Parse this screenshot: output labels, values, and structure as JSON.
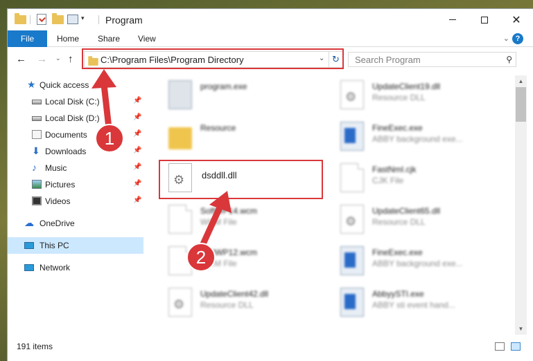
{
  "window": {
    "title": "Program",
    "min_glyph": "—",
    "max_glyph": "",
    "close_glyph": "✕"
  },
  "quick_access_toolbar": {
    "icons": [
      "folder-icon",
      "properties-check-icon",
      "new-folder-icon",
      "customize-icon"
    ],
    "dropdown_glyph": "▾"
  },
  "ribbon": {
    "tabs": [
      "File",
      "Home",
      "Share",
      "View"
    ],
    "expand_glyph": "⌄",
    "help_glyph": "?"
  },
  "navigation": {
    "back_glyph": "←",
    "forward_glyph": "→",
    "recent_glyph": "⌄",
    "up_glyph": "↑"
  },
  "address": {
    "path": "C:\\Program Files\\Program Directory",
    "dropdown_glyph": "⌄",
    "refresh_glyph": "↻"
  },
  "search": {
    "placeholder": "Search Program",
    "icon_glyph": "⚲"
  },
  "sidebar": {
    "items": [
      {
        "label": "Quick access",
        "icon": "star-icon",
        "pin": ""
      },
      {
        "label": "Local Disk (C:)",
        "icon": "disk-icon",
        "pin": "📌"
      },
      {
        "label": "Local Disk (D:)",
        "icon": "disk-icon",
        "pin": "📌"
      },
      {
        "label": "Documents",
        "icon": "documents-icon",
        "pin": "📌"
      },
      {
        "label": "Downloads",
        "icon": "download-icon",
        "pin": "📌"
      },
      {
        "label": "Music",
        "icon": "music-icon",
        "pin": "📌"
      },
      {
        "label": "Pictures",
        "icon": "pictures-icon",
        "pin": "📌"
      },
      {
        "label": "Videos",
        "icon": "videos-icon",
        "pin": "📌"
      },
      {
        "label": "OneDrive",
        "icon": "cloud-icon",
        "pin": ""
      },
      {
        "label": "This PC",
        "icon": "computer-icon",
        "pin": ""
      },
      {
        "label": "Network",
        "icon": "network-icon",
        "pin": ""
      }
    ],
    "selected": "This PC"
  },
  "files": {
    "left": [
      {
        "name": "program.exe",
        "type": "",
        "icon": "program-icon"
      },
      {
        "name": "Resource",
        "type": "",
        "icon": "folder-icon"
      },
      {
        "name": "dsddll.dll",
        "type": "",
        "icon": "dll-icon"
      },
      {
        "name": "SoftWP14.wcm",
        "type": "WCM File",
        "icon": "document-icon"
      },
      {
        "name": "SoftWP12.wcm",
        "type": "WCM File",
        "icon": "document-icon"
      },
      {
        "name": "UpdateClient42.dll",
        "type": "Resource DLL",
        "icon": "dll-icon"
      }
    ],
    "right": [
      {
        "name": "UpdateClient19.dll",
        "type": "Resource DLL",
        "icon": "dll-icon"
      },
      {
        "name": "FineExec.exe",
        "type": "ABBY background exe...",
        "icon": "exe-icon"
      },
      {
        "name": "FastNmI.cjk",
        "type": "CJK File",
        "icon": "document-icon"
      },
      {
        "name": "UpdateClient65.dll",
        "type": "Resource DLL",
        "icon": "dll-icon"
      },
      {
        "name": "FineExec.exe",
        "type": "ABBY background exe...",
        "icon": "exe-icon"
      },
      {
        "name": "AbbyySTI.exe",
        "type": "ABBY sti event hand...",
        "icon": "exe-icon"
      }
    ]
  },
  "status": {
    "item_count": "191 items"
  },
  "annotations": {
    "steps": [
      "1",
      "2"
    ],
    "color": "#d9373a"
  }
}
